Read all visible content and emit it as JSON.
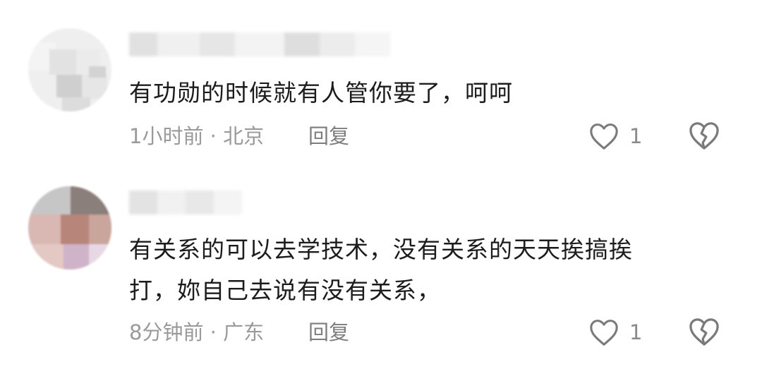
{
  "comments": [
    {
      "text": "有功勋的时候就有人管你要了，呵呵",
      "time": "1小时前",
      "separator": "·",
      "location": "北京",
      "reply_label": "回复",
      "like_count": "1",
      "avatar_blurred": true,
      "username_blurred": true
    },
    {
      "text_line1": "有关系的可以去学技术，没有关系的天天挨搞挨",
      "text_line2": "打，妳自己去说有没有关系，",
      "time": "8分钟前",
      "separator": "·",
      "location": "广东",
      "reply_label": "回复",
      "like_count": "1",
      "avatar_blurred": true,
      "username_blurred": true
    }
  ],
  "icons": {
    "like": "heart-outline-icon",
    "dislike": "broken-heart-icon"
  },
  "colors": {
    "text": "#1c1c1c",
    "meta": "#9a9a9a",
    "icon": "#7a7a7a"
  }
}
